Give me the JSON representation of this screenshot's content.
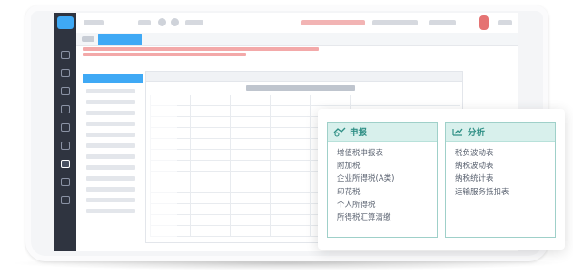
{
  "panel": {
    "cards": [
      {
        "title": "申报",
        "icon": "declare-icon",
        "items": [
          "增值税申报表",
          "附加税",
          "企业所得税(A类)",
          "印花税",
          "个人所得税",
          "所得税汇算清缴"
        ]
      },
      {
        "title": "分析",
        "icon": "analysis-icon",
        "items": [
          "税负波动表",
          "纳税波动表",
          "纳税统计表",
          "运输服务抵扣表"
        ]
      }
    ]
  },
  "colors": {
    "accent": "#3fa9f5",
    "card_border": "#9fd0c9",
    "card_header": "#d8f0ec",
    "card_title": "#2f8f85",
    "sidebar": "#2f3440"
  }
}
